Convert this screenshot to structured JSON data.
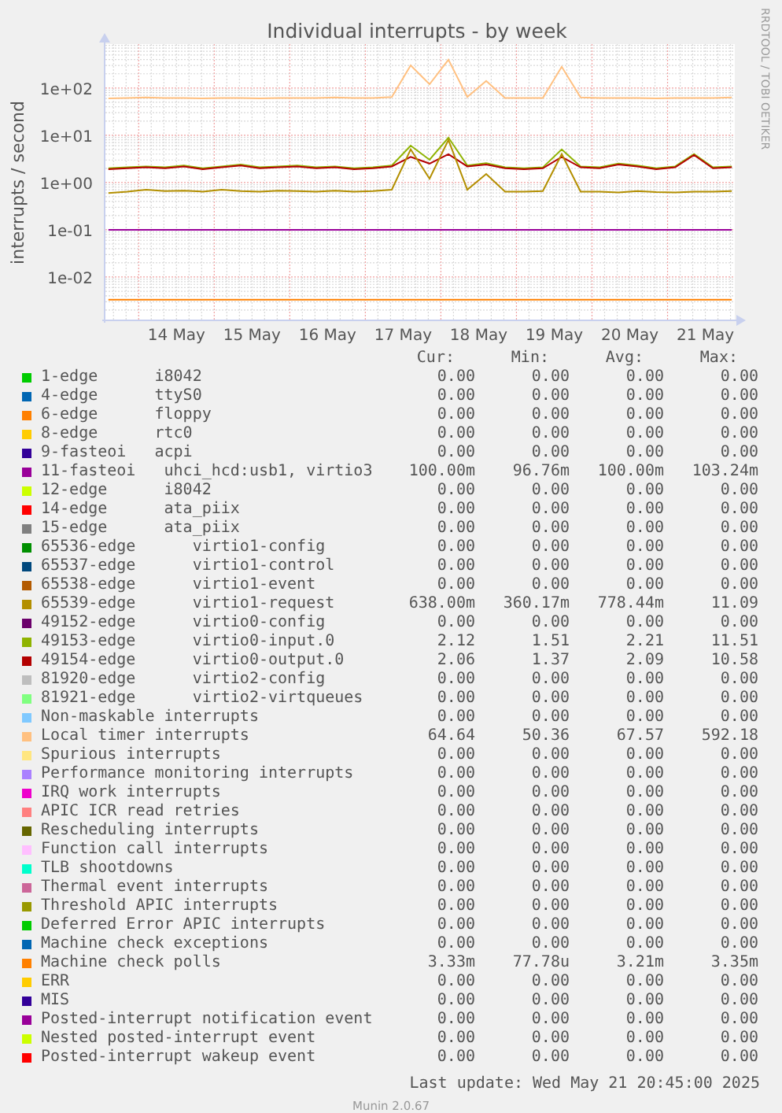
{
  "graph": {
    "title": "Individual interrupts - by week",
    "credit": "RRDTOOL / TOBI OETIKER",
    "y_axis_label": "interrupts / second",
    "y_tick_labels": [
      "1e+02",
      "1e+01",
      "1e+00",
      "1e-01",
      "1e-02"
    ],
    "x_tick_labels": [
      "14 May",
      "15 May",
      "16 May",
      "17 May",
      "18 May",
      "19 May",
      "20 May",
      "21 May"
    ]
  },
  "legend": {
    "columns": [
      "Cur:",
      "Min:",
      "Avg:",
      "Max:"
    ],
    "rows": [
      {
        "label": "1-edge      i8042",
        "color": "#00cc00",
        "cur": "0.00",
        "min": "0.00",
        "avg": "0.00",
        "max": "0.00"
      },
      {
        "label": "4-edge      ttyS0",
        "color": "#0066b3",
        "cur": "0.00",
        "min": "0.00",
        "avg": "0.00",
        "max": "0.00"
      },
      {
        "label": "6-edge      floppy",
        "color": "#ff8000",
        "cur": "0.00",
        "min": "0.00",
        "avg": "0.00",
        "max": "0.00"
      },
      {
        "label": "8-edge      rtc0",
        "color": "#ffcc00",
        "cur": "0.00",
        "min": "0.00",
        "avg": "0.00",
        "max": "0.00"
      },
      {
        "label": "9-fasteoi   acpi",
        "color": "#330099",
        "cur": "0.00",
        "min": "0.00",
        "avg": "0.00",
        "max": "0.00"
      },
      {
        "label": "11-fasteoi   uhci_hcd:usb1, virtio3",
        "color": "#990099",
        "cur": "100.00m",
        "min": "96.76m",
        "avg": "100.00m",
        "max": "103.24m"
      },
      {
        "label": "12-edge      i8042",
        "color": "#ccff00",
        "cur": "0.00",
        "min": "0.00",
        "avg": "0.00",
        "max": "0.00"
      },
      {
        "label": "14-edge      ata_piix",
        "color": "#ff0000",
        "cur": "0.00",
        "min": "0.00",
        "avg": "0.00",
        "max": "0.00"
      },
      {
        "label": "15-edge      ata_piix",
        "color": "#808080",
        "cur": "0.00",
        "min": "0.00",
        "avg": "0.00",
        "max": "0.00"
      },
      {
        "label": "65536-edge      virtio1-config",
        "color": "#008f00",
        "cur": "0.00",
        "min": "0.00",
        "avg": "0.00",
        "max": "0.00"
      },
      {
        "label": "65537-edge      virtio1-control",
        "color": "#00487d",
        "cur": "0.00",
        "min": "0.00",
        "avg": "0.00",
        "max": "0.00"
      },
      {
        "label": "65538-edge      virtio1-event",
        "color": "#b35a00",
        "cur": "0.00",
        "min": "0.00",
        "avg": "0.00",
        "max": "0.00"
      },
      {
        "label": "65539-edge      virtio1-request",
        "color": "#b38f00",
        "cur": "638.00m",
        "min": "360.17m",
        "avg": "778.44m",
        "max": "11.09"
      },
      {
        "label": "49152-edge      virtio0-config",
        "color": "#6b006b",
        "cur": "0.00",
        "min": "0.00",
        "avg": "0.00",
        "max": "0.00"
      },
      {
        "label": "49153-edge      virtio0-input.0",
        "color": "#8fb300",
        "cur": "2.12",
        "min": "1.51",
        "avg": "2.21",
        "max": "11.51"
      },
      {
        "label": "49154-edge      virtio0-output.0",
        "color": "#b30000",
        "cur": "2.06",
        "min": "1.37",
        "avg": "2.09",
        "max": "10.58"
      },
      {
        "label": "81920-edge      virtio2-config",
        "color": "#bebebe",
        "cur": "0.00",
        "min": "0.00",
        "avg": "0.00",
        "max": "0.00"
      },
      {
        "label": "81921-edge      virtio2-virtqueues",
        "color": "#80ff80",
        "cur": "0.00",
        "min": "0.00",
        "avg": "0.00",
        "max": "0.00"
      },
      {
        "label": "Non-maskable interrupts",
        "color": "#80c9ff",
        "cur": "0.00",
        "min": "0.00",
        "avg": "0.00",
        "max": "0.00"
      },
      {
        "label": "Local timer interrupts",
        "color": "#ffc080",
        "cur": "64.64",
        "min": "50.36",
        "avg": "67.57",
        "max": "592.18"
      },
      {
        "label": "Spurious interrupts",
        "color": "#ffe680",
        "cur": "0.00",
        "min": "0.00",
        "avg": "0.00",
        "max": "0.00"
      },
      {
        "label": "Performance monitoring interrupts",
        "color": "#aa80ff",
        "cur": "0.00",
        "min": "0.00",
        "avg": "0.00",
        "max": "0.00"
      },
      {
        "label": "IRQ work interrupts",
        "color": "#ee00cc",
        "cur": "0.00",
        "min": "0.00",
        "avg": "0.00",
        "max": "0.00"
      },
      {
        "label": "APIC ICR read retries",
        "color": "#ff8080",
        "cur": "0.00",
        "min": "0.00",
        "avg": "0.00",
        "max": "0.00"
      },
      {
        "label": "Rescheduling interrupts",
        "color": "#666600",
        "cur": "0.00",
        "min": "0.00",
        "avg": "0.00",
        "max": "0.00"
      },
      {
        "label": "Function call interrupts",
        "color": "#ffbfff",
        "cur": "0.00",
        "min": "0.00",
        "avg": "0.00",
        "max": "0.00"
      },
      {
        "label": "TLB shootdowns",
        "color": "#00ffcc",
        "cur": "0.00",
        "min": "0.00",
        "avg": "0.00",
        "max": "0.00"
      },
      {
        "label": "Thermal event interrupts",
        "color": "#cc6699",
        "cur": "0.00",
        "min": "0.00",
        "avg": "0.00",
        "max": "0.00"
      },
      {
        "label": "Threshold APIC interrupts",
        "color": "#999900",
        "cur": "0.00",
        "min": "0.00",
        "avg": "0.00",
        "max": "0.00"
      },
      {
        "label": "Deferred Error APIC interrupts",
        "color": "#00cc00",
        "cur": "0.00",
        "min": "0.00",
        "avg": "0.00",
        "max": "0.00"
      },
      {
        "label": "Machine check exceptions",
        "color": "#0066b3",
        "cur": "0.00",
        "min": "0.00",
        "avg": "0.00",
        "max": "0.00"
      },
      {
        "label": "Machine check polls",
        "color": "#ff8000",
        "cur": "3.33m",
        "min": "77.78u",
        "avg": "3.21m",
        "max": "3.35m"
      },
      {
        "label": "ERR",
        "color": "#ffcc00",
        "cur": "0.00",
        "min": "0.00",
        "avg": "0.00",
        "max": "0.00"
      },
      {
        "label": "MIS",
        "color": "#330099",
        "cur": "0.00",
        "min": "0.00",
        "avg": "0.00",
        "max": "0.00"
      },
      {
        "label": "Posted-interrupt notification event",
        "color": "#990099",
        "cur": "0.00",
        "min": "0.00",
        "avg": "0.00",
        "max": "0.00"
      },
      {
        "label": "Nested posted-interrupt event",
        "color": "#ccff00",
        "cur": "0.00",
        "min": "0.00",
        "avg": "0.00",
        "max": "0.00"
      },
      {
        "label": "Posted-interrupt wakeup event",
        "color": "#ff0000",
        "cur": "0.00",
        "min": "0.00",
        "avg": "0.00",
        "max": "0.00"
      }
    ]
  },
  "last_update": "Last update: Wed May 21 20:45:00 2025",
  "footer": "Munin 2.0.67"
}
